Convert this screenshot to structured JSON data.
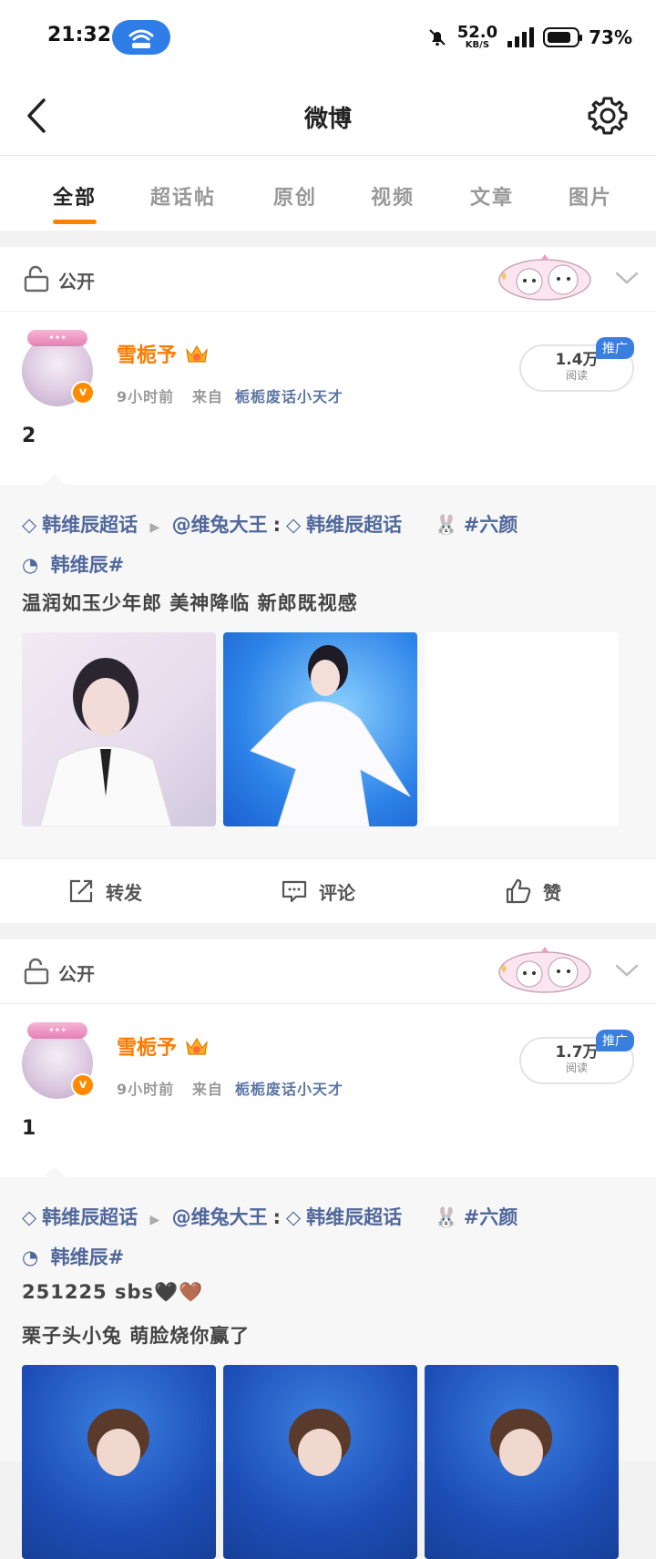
{
  "status": {
    "time": "21:32",
    "net_speed": "52.0",
    "net_unit": "KB/S",
    "battery": "73%"
  },
  "nav": {
    "title": "微博"
  },
  "tabs": [
    {
      "label": "全部"
    },
    {
      "label": "超话帖"
    },
    {
      "label": "原创"
    },
    {
      "label": "视频"
    },
    {
      "label": "文章"
    },
    {
      "label": "图片"
    }
  ],
  "colors": {
    "accent": "#ff8200",
    "link": "#50689b",
    "username": "#ff7a00",
    "promo": "#3a7fe0"
  },
  "posts": [
    {
      "visibility": "公开",
      "user": "雪栀予",
      "time": "9小时前",
      "from": "来自",
      "source": "栀栀废话小天才",
      "reads": "1.4万",
      "reads_label": "阅读",
      "promo": "推广",
      "text": "2",
      "quote": {
        "tag1": "韩维辰超话",
        "mention": "@维兔大王",
        "colon": ":",
        "tag2": "韩维辰超话",
        "hashtag_start": "#六颜",
        "hashtag_end": "韩维辰#",
        "lines": [
          "温润如玉少年郎 美神降临 新郎既视感"
        ]
      },
      "actions": {
        "repost": "转发",
        "comment": "评论",
        "like": "赞"
      }
    },
    {
      "visibility": "公开",
      "user": "雪栀予",
      "time": "9小时前",
      "from": "来自",
      "source": "栀栀废话小天才",
      "reads": "1.7万",
      "reads_label": "阅读",
      "promo": "推广",
      "text": "1",
      "quote": {
        "tag1": "韩维辰超话",
        "mention": "@维兔大王",
        "colon": ":",
        "tag2": "韩维辰超话",
        "hashtag_start": "#六颜",
        "hashtag_end": "韩维辰#",
        "lines": [
          "251225 sbs🖤🤎",
          "栗子头小兔 萌脸烧你赢了"
        ]
      }
    }
  ]
}
